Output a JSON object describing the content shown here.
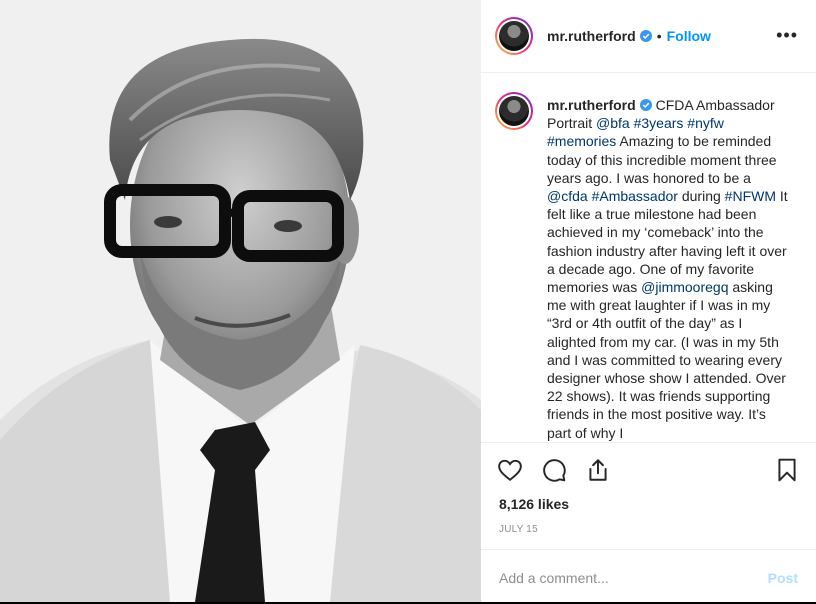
{
  "post": {
    "author": "mr.rutherford",
    "follow_label": "Follow",
    "separator": "•",
    "more_label": "•••",
    "caption": [
      {
        "t": "text",
        "v": " CFDA Ambassador Portrait "
      },
      {
        "t": "link",
        "v": "@bfa"
      },
      {
        "t": "text",
        "v": " "
      },
      {
        "t": "link",
        "v": "#3years"
      },
      {
        "t": "text",
        "v": " "
      },
      {
        "t": "link",
        "v": "#nyfw"
      },
      {
        "t": "text",
        "v": " "
      },
      {
        "t": "link",
        "v": "#memories"
      },
      {
        "t": "text",
        "v": " Amazing to be reminded today of this incredible moment three years ago. I was honored to be a "
      },
      {
        "t": "link",
        "v": "@cfda"
      },
      {
        "t": "text",
        "v": " "
      },
      {
        "t": "link",
        "v": "#Ambassador"
      },
      {
        "t": "text",
        "v": " during "
      },
      {
        "t": "link",
        "v": "#NFWM"
      },
      {
        "t": "text",
        "v": " It felt like a true milestone had been achieved in my ‘comeback’ into the fashion industry after having left it over a decade ago. One of my favorite memories was "
      },
      {
        "t": "link",
        "v": "@jimmooregq"
      },
      {
        "t": "text",
        "v": " asking me with great laughter if I was in my “3rd or 4th outfit of the day” as I alighted from my car. (I was in my 5th and I was committed to wearing every designer whose show I attended. Over 22 shows). It was friends supporting friends in the most positive way. It’s part of why I"
      }
    ],
    "likes": "8,126 likes",
    "date": "JULY 15"
  },
  "comment": {
    "placeholder": "Add a comment...",
    "post_label": "Post"
  },
  "colors": {
    "link": "#00376b",
    "follow": "#0095f6",
    "post_disabled": "#b2dffc",
    "verified": "#3897f0"
  },
  "icons": [
    "heart-icon",
    "comment-icon",
    "share-icon",
    "bookmark-icon",
    "verified-badge-icon",
    "more-options-icon"
  ]
}
